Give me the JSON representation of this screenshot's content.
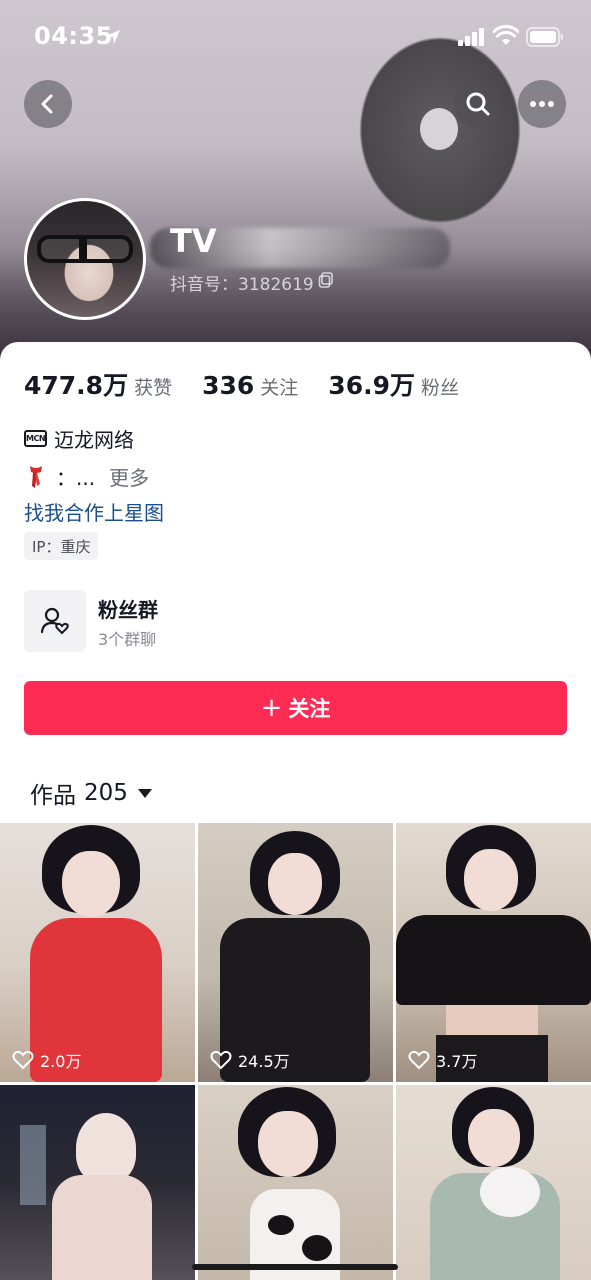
{
  "status_bar": {
    "time": "04:35"
  },
  "header": {
    "back_icon": "chevron-left-icon",
    "search_icon": "search-icon",
    "more_icon": "more-dots-icon"
  },
  "profile": {
    "name": "TV",
    "douyin_id": "抖音号：3182619"
  },
  "stats": [
    {
      "value": "477.8万",
      "label": "获赞"
    },
    {
      "value": "336",
      "label": "关注"
    },
    {
      "value": "36.9万",
      "label": "粉丝"
    }
  ],
  "mcn": {
    "icon_text": "MCN",
    "name": "迈龙网络"
  },
  "bio": {
    "text": "：...",
    "more": "更多"
  },
  "star_link": "找我合作上星图",
  "ip": "IP：重庆",
  "fan_group": {
    "title": "粉丝群",
    "subtitle": "3个群聊"
  },
  "follow_button": {
    "plus": "+",
    "label": "关注"
  },
  "works": {
    "label": "作品",
    "count": "205"
  },
  "videos": [
    {
      "likes": "2.0万",
      "dress": "#e0353b",
      "bg": "#c9b6a4"
    },
    {
      "likes": "24.5万",
      "dress": "#1c1a1d",
      "bg": "#c2b9ad"
    },
    {
      "likes": "3.7万",
      "dress": "#151316",
      "bg": "#cdbfb1"
    },
    {
      "likes": "",
      "dress": "#ecd6d2",
      "bg": "#2b2a33"
    },
    {
      "likes": "",
      "dress": "#f3f1ef",
      "bg": "#c4b8a9"
    },
    {
      "likes": "",
      "dress": "#a8b9b1",
      "bg": "#d8ccc0"
    }
  ],
  "colors": {
    "accent": "#fe2c55",
    "link": "#1a4f8f"
  }
}
